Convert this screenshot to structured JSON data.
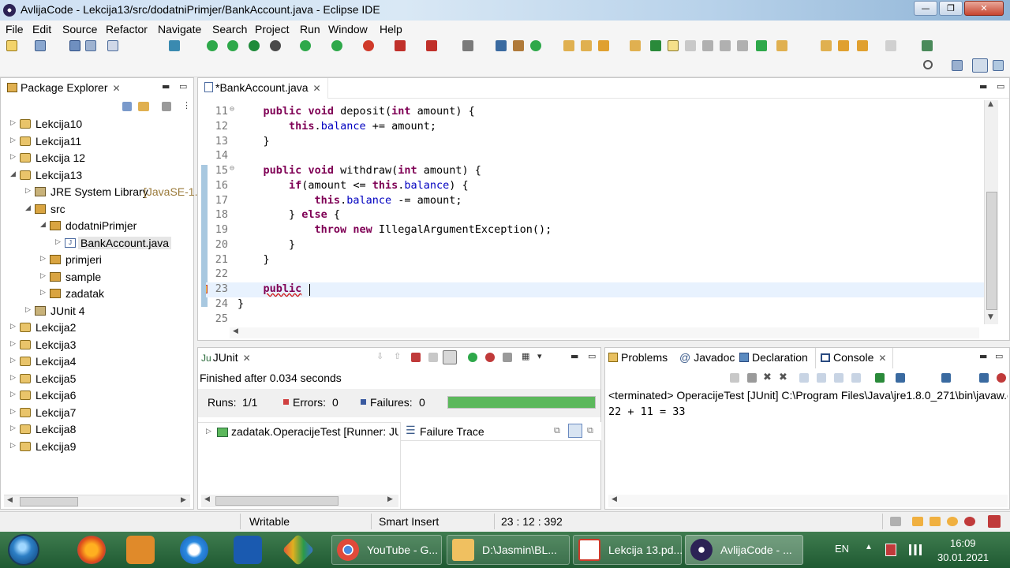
{
  "window": {
    "title": "AvlijaCode - Lekcija13/src/dodatniPrimjer/BankAccount.java - Eclipse IDE"
  },
  "menu": [
    "File",
    "Edit",
    "Source",
    "Refactor",
    "Navigate",
    "Search",
    "Project",
    "Run",
    "Window",
    "Help"
  ],
  "package_explorer": {
    "tab_label": "Package Explorer",
    "items": [
      {
        "label": "Lekcija10",
        "suffix": "",
        "type": "project"
      },
      {
        "label": "Lekcija11",
        "suffix": "",
        "type": "project"
      },
      {
        "label": "Lekcija 12",
        "suffix": "",
        "type": "project"
      },
      {
        "label": "Lekcija13",
        "suffix": "",
        "type": "project"
      },
      {
        "label": "JRE System Library",
        "suffix": " [JavaSE-1.",
        "type": "library"
      },
      {
        "label": "src",
        "suffix": "",
        "type": "folder"
      },
      {
        "label": "dodatniPrimjer",
        "suffix": "",
        "type": "package"
      },
      {
        "label": "BankAccount.java",
        "suffix": "",
        "type": "file"
      },
      {
        "label": "primjeri",
        "suffix": "",
        "type": "package"
      },
      {
        "label": "sample",
        "suffix": "",
        "type": "package"
      },
      {
        "label": "zadatak",
        "suffix": "",
        "type": "package"
      },
      {
        "label": "JUnit 4",
        "suffix": "",
        "type": "library"
      },
      {
        "label": "Lekcija2",
        "suffix": "",
        "type": "project"
      },
      {
        "label": "Lekcija3",
        "suffix": "",
        "type": "project"
      },
      {
        "label": "Lekcija4",
        "suffix": "",
        "type": "project"
      },
      {
        "label": "Lekcija5",
        "suffix": "",
        "type": "project"
      },
      {
        "label": "Lekcija6",
        "suffix": "",
        "type": "project"
      },
      {
        "label": "Lekcija7",
        "suffix": "",
        "type": "project"
      },
      {
        "label": "Lekcija8",
        "suffix": "",
        "type": "project"
      },
      {
        "label": "Lekcija9",
        "suffix": "",
        "type": "project"
      }
    ]
  },
  "editor": {
    "tab_label": "*BankAccount.java",
    "lines": [
      {
        "n": "11",
        "text": "    public void deposit(int amount) {"
      },
      {
        "n": "12",
        "text": "        this.balance += amount;"
      },
      {
        "n": "13",
        "text": "    }"
      },
      {
        "n": "14",
        "text": ""
      },
      {
        "n": "15",
        "text": "    public void withdraw(int amount) {"
      },
      {
        "n": "16",
        "text": "        if(amount <= this.balance) {"
      },
      {
        "n": "17",
        "text": "            this.balance -= amount;"
      },
      {
        "n": "18",
        "text": "        } else {"
      },
      {
        "n": "19",
        "text": "            throw new IllegalArgumentException();"
      },
      {
        "n": "20",
        "text": "        }"
      },
      {
        "n": "21",
        "text": "    }"
      },
      {
        "n": "22",
        "text": ""
      },
      {
        "n": "23",
        "text": "    public "
      },
      {
        "n": "24",
        "text": "}"
      },
      {
        "n": "25",
        "text": ""
      }
    ]
  },
  "junit": {
    "tab_label": "JUnit",
    "finished": "Finished after 0.034 seconds",
    "runs_label": "Runs:",
    "runs_value": "1/1",
    "errors_label": "Errors:",
    "errors_value": "0",
    "failures_label": "Failures:",
    "failures_value": "0",
    "progress": 1.0,
    "test_item": "zadatak.OperacijeTest [Runner: JUı",
    "failure_trace": "Failure Trace"
  },
  "console_panel": {
    "tabs": [
      "Problems",
      "Javadoc",
      "Declaration",
      "Console"
    ],
    "terminated": "<terminated> OperacijeTest [JUnit] C:\\Program Files\\Java\\jre1.8.0_271\\bin\\javaw.e",
    "output": "22 + 11 = 33"
  },
  "status": {
    "writable": "Writable",
    "insert_mode": "Smart Insert",
    "position": "23 : 12 : 392"
  },
  "taskbar": {
    "tasks": [
      {
        "label": "YouTube - G...",
        "icon": "chrome-icon"
      },
      {
        "label": "D:\\Jasmin\\BL...",
        "icon": "folder-icon"
      },
      {
        "label": "Lekcija 13.pd...",
        "icon": "pdf-icon"
      },
      {
        "label": "AvlijaCode - ...",
        "icon": "eclipse-icon"
      }
    ],
    "language": "EN",
    "time": "16:09",
    "date": "30.01.2021"
  },
  "colors": {
    "progress_green": "#5cb85c",
    "keyword": "#7f0055",
    "field": "#0000c0",
    "taskbar": "#2e6b40"
  }
}
